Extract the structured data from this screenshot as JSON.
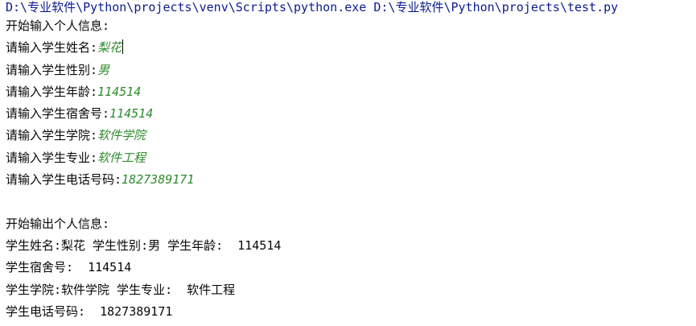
{
  "command_line": "D:\\专业软件\\Python\\projects\\venv\\Scripts\\python.exe D:\\专业软件\\Python\\projects\\test.py",
  "input_section": {
    "header": "开始输入个人信息:",
    "prompts": [
      {
        "label": "请输入学生姓名:",
        "value": "梨花"
      },
      {
        "label": "请输入学生性别:",
        "value": "男"
      },
      {
        "label": "请输入学生年龄:",
        "value": "114514"
      },
      {
        "label": "请输入学生宿舍号:",
        "value": "114514"
      },
      {
        "label": "请输入学生学院:",
        "value": "软件学院"
      },
      {
        "label": "请输入学生专业:",
        "value": "软件工程"
      },
      {
        "label": "请输入学生电话号码:",
        "value": "1827389171"
      }
    ]
  },
  "output_section": {
    "header": "开始输出个人信息:",
    "lines": [
      "学生姓名:梨花 学生性别:男 学生年龄:  114514",
      "学生宿舍号:  114514",
      "学生学院:软件学院 学生专业:  软件工程",
      "学生电话号码:  1827389171"
    ]
  },
  "colors": {
    "command_text": "#0a1c8c",
    "user_input": "#2e8b2e",
    "program_output": "#080808",
    "background": "#ffffff"
  }
}
